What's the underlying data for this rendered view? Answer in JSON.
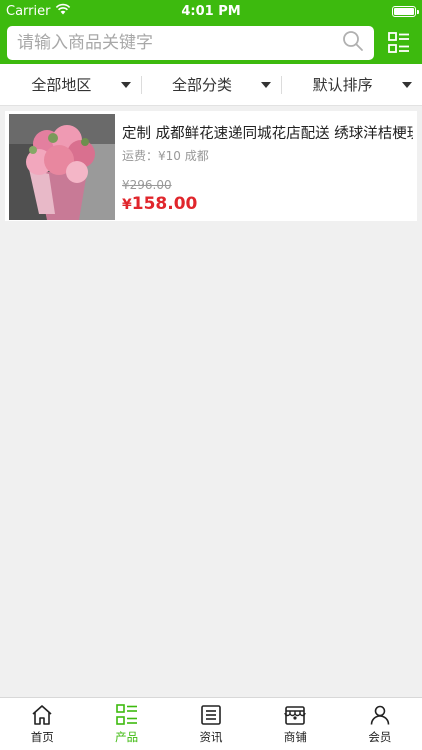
{
  "status_bar": {
    "carrier": "Carrier",
    "time": "4:01 PM"
  },
  "search": {
    "placeholder": "请输入商品关键字",
    "value": ""
  },
  "filters": [
    {
      "label": "全部地区"
    },
    {
      "label": "全部分类"
    },
    {
      "label": "默认排序"
    }
  ],
  "products": [
    {
      "title": "定制 成都鲜花速递同城花店配送 绣球洋桔梗玫瑰",
      "shipping": "运费：¥10 成都",
      "old_price": "¥296.00",
      "price_symbol": "¥",
      "price": "158.00"
    }
  ],
  "tabs": [
    {
      "label": "首页",
      "icon": "home-icon",
      "active": false
    },
    {
      "label": "产品",
      "icon": "product-list-icon",
      "active": true
    },
    {
      "label": "资讯",
      "icon": "news-icon",
      "active": false
    },
    {
      "label": "商铺",
      "icon": "store-icon",
      "active": false
    },
    {
      "label": "会员",
      "icon": "member-icon",
      "active": false
    }
  ],
  "colors": {
    "accent": "#3dba0e",
    "price": "#e0262c"
  }
}
